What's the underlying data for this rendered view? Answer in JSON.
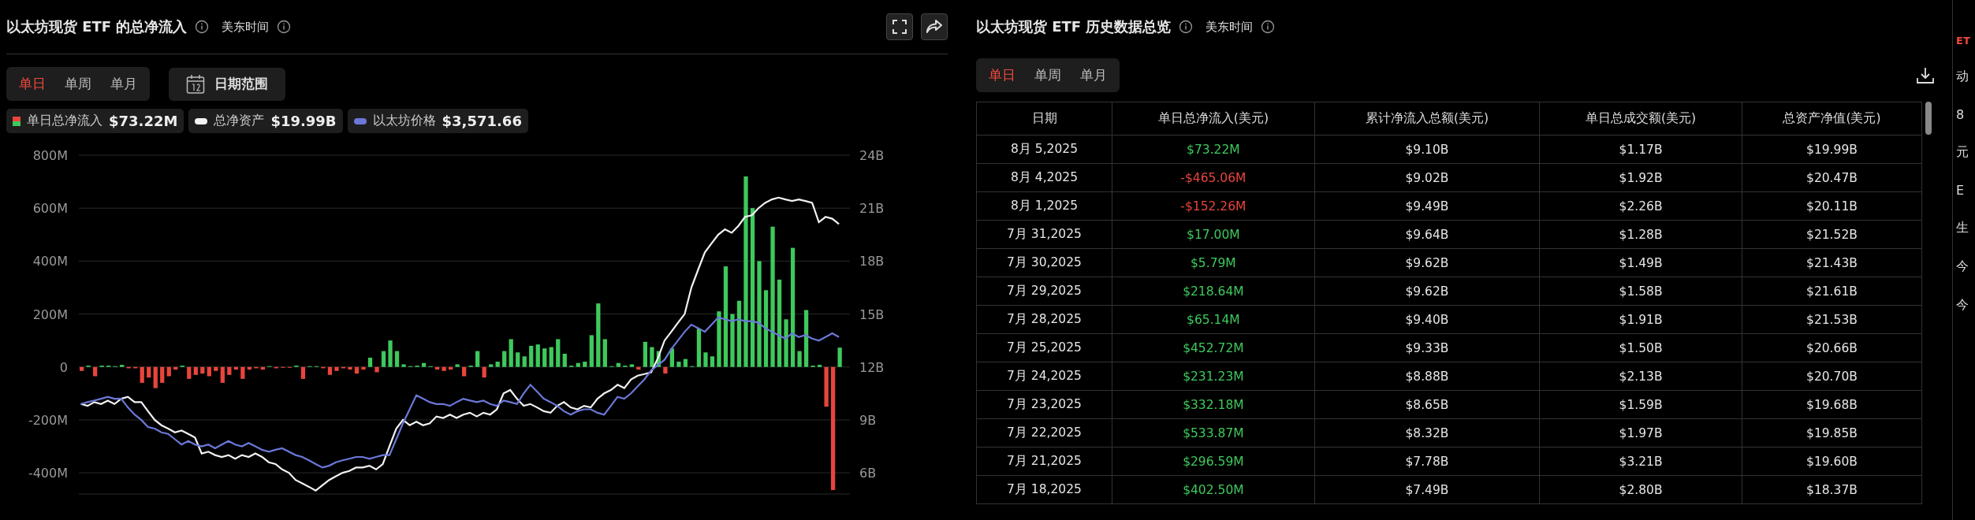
{
  "left_panel": {
    "title": "以太坊现货 ETF 的总净流入",
    "timezone": "美东时间",
    "period_tabs": [
      {
        "label": "单日",
        "selected": true
      },
      {
        "label": "单周",
        "selected": false
      },
      {
        "label": "单月",
        "selected": false
      }
    ],
    "date_range_button": "日期范围",
    "legend": [
      {
        "value": "$73.22M"
      },
      {
        "value": "$19.99B"
      },
      {
        "value": "$3,571.66"
      }
    ],
    "chart_data": {
      "type": "bar",
      "grid": true,
      "stacked": true,
      "ylim": [
        -480,
        800
      ],
      "y2lim": [
        4.8,
        24
      ],
      "yticks": [
        {
          "value": 800,
          "label": "800M"
        },
        {
          "value": 600,
          "label": "600M"
        },
        {
          "value": 400,
          "label": "400M"
        },
        {
          "value": 200,
          "label": "200M"
        },
        {
          "value": 0,
          "label": "0"
        },
        {
          "value": -200,
          "label": "-200M"
        },
        {
          "value": -400,
          "label": "-400M"
        }
      ],
      "y2ticks": [
        {
          "value": 24,
          "label": "24B"
        },
        {
          "value": 21,
          "label": "21B"
        },
        {
          "value": 18,
          "label": "18B"
        },
        {
          "value": 15,
          "label": "15B"
        },
        {
          "value": 12,
          "label": "12B"
        },
        {
          "value": 9,
          "label": "9B"
        },
        {
          "value": 6,
          "label": "6B"
        }
      ],
      "series": [
        {
          "name": "单日总净流入",
          "type": "bar",
          "color": "#3ec95c",
          "values": [
            null,
            5,
            null,
            5,
            5,
            3,
            8,
            null,
            null,
            null,
            null,
            null,
            null,
            null,
            null,
            5,
            null,
            null,
            null,
            null,
            null,
            null,
            null,
            null,
            null,
            null,
            null,
            null,
            3,
            null,
            null,
            null,
            5,
            null,
            3,
            3,
            null,
            null,
            null,
            null,
            null,
            null,
            null,
            35,
            null,
            60,
            100,
            60,
            10,
            3,
            5,
            15,
            3,
            null,
            null,
            null,
            10,
            null,
            5,
            60,
            null,
            10,
            20,
            60,
            105,
            55,
            40,
            80,
            85,
            70,
            75,
            105,
            50,
            5,
            15,
            20,
            120,
            240,
            105,
            3,
            15,
            5,
            10,
            null,
            95,
            75,
            60,
            null,
            70,
            20,
            30,
            3,
            145,
            55,
            40,
            210,
            380,
            200,
            250,
            720,
            600,
            400,
            290,
            530,
            330,
            180,
            450,
            60,
            215,
            5,
            8,
            null,
            null,
            73
          ]
        },
        {
          "name": "总净资产",
          "type": "line",
          "color": "#f2f2f2",
          "values": [
            -140,
            -147,
            -133,
            -140,
            -127,
            -140,
            -120,
            -113,
            -133,
            -133,
            -167,
            -200,
            -220,
            -233,
            -247,
            -240,
            -253,
            -267,
            -327,
            -320,
            -333,
            -340,
            -333,
            -347,
            -333,
            -340,
            -327,
            -340,
            -360,
            -367,
            -387,
            -400,
            -427,
            -440,
            -453,
            -467,
            -447,
            -427,
            -413,
            -400,
            -393,
            -380,
            -380,
            -373,
            -387,
            -367,
            -300,
            -233,
            -200,
            -220,
            -207,
            -220,
            -213,
            -187,
            -193,
            -180,
            -193,
            -180,
            -173,
            -187,
            -173,
            -180,
            -160,
            -100,
            -87,
            -120,
            -147,
            -140,
            -153,
            -167,
            -173,
            -147,
            -133,
            -153,
            -160,
            -147,
            -153,
            -120,
            -100,
            -87,
            -67,
            -80,
            -47,
            -33,
            -27,
            -20,
            33,
            100,
            133,
            167,
            200,
            300,
            367,
            433,
            467,
            500,
            520,
            507,
            533,
            567,
            573,
            600,
            620,
            633,
            640,
            633,
            627,
            633,
            627,
            620,
            547,
            567,
            560,
            540
          ]
        },
        {
          "name": "以太坊价格",
          "type": "line",
          "color": "#6b78d8",
          "values": [
            -140,
            -133,
            -127,
            -120,
            -113,
            -120,
            -120,
            -153,
            -180,
            -200,
            -227,
            -233,
            -247,
            -253,
            -273,
            -293,
            -280,
            -293,
            -300,
            -293,
            -307,
            -293,
            -280,
            -293,
            -300,
            -287,
            -300,
            -313,
            -320,
            -313,
            -307,
            -320,
            -333,
            -340,
            -353,
            -367,
            -380,
            -373,
            -360,
            -353,
            -347,
            -340,
            -340,
            -347,
            -340,
            -333,
            -333,
            -273,
            -213,
            -160,
            -107,
            -120,
            -133,
            -140,
            -140,
            -147,
            -133,
            -120,
            -127,
            -133,
            -127,
            -140,
            -147,
            -127,
            -133,
            -140,
            -100,
            -67,
            -93,
            -120,
            -133,
            -147,
            -167,
            -180,
            -167,
            -160,
            -160,
            -173,
            -180,
            -147,
            -113,
            -120,
            -100,
            -73,
            -47,
            -13,
            7,
            27,
            67,
            100,
            133,
            160,
            147,
            133,
            160,
            187,
            180,
            173,
            180,
            173,
            173,
            167,
            147,
            133,
            120,
            107,
            127,
            113,
            120,
            107,
            100,
            113,
            127,
            113
          ]
        },
        {
          "type": "bar",
          "color": "#e8453c",
          "values": [
            -15,
            null,
            -35,
            null,
            null,
            null,
            null,
            -5,
            -5,
            -60,
            -40,
            -80,
            -60,
            -35,
            -10,
            null,
            -45,
            -30,
            -25,
            -35,
            -15,
            -60,
            -30,
            -10,
            -45,
            -10,
            -5,
            -10,
            null,
            -5,
            -3,
            -3,
            null,
            -45,
            null,
            null,
            -5,
            -30,
            -15,
            -5,
            -10,
            -25,
            -10,
            null,
            -20,
            null,
            null,
            null,
            null,
            null,
            null,
            null,
            null,
            -10,
            -15,
            -10,
            null,
            -35,
            null,
            null,
            -40,
            null,
            null,
            null,
            null,
            null,
            null,
            null,
            null,
            null,
            null,
            null,
            null,
            null,
            null,
            null,
            null,
            null,
            null,
            null,
            null,
            null,
            null,
            -10,
            null,
            null,
            null,
            -25,
            null,
            null,
            null,
            null,
            null,
            null,
            null,
            null,
            null,
            null,
            null,
            null,
            null,
            null,
            null,
            null,
            null,
            null,
            null,
            null,
            null,
            null,
            null,
            -150,
            -465,
            null
          ]
        }
      ]
    }
  },
  "right_panel": {
    "title": "以太坊现货 ETF 历史数据总览",
    "timezone": "美东时间",
    "period_tabs": [
      {
        "label": "单日",
        "selected": true
      },
      {
        "label": "单周",
        "selected": false
      },
      {
        "label": "单月",
        "selected": false
      }
    ],
    "table": {
      "columns": [
        "日期",
        "单日总净流入(美元)",
        "累计净流入总额(美元)",
        "单日总成交额(美元)",
        "总资产净值(美元)"
      ],
      "rows": [
        {
          "date": "8月 5,2025",
          "inflow": "$73.22M",
          "color": "#3ec95c",
          "cumulative": "$9.10B",
          "volume": "$1.17B",
          "net_assets": "$19.99B"
        },
        {
          "date": "8月 4,2025",
          "inflow": "-$465.06M",
          "color": "#e8453c",
          "cumulative": "$9.02B",
          "volume": "$1.92B",
          "net_assets": "$20.47B"
        },
        {
          "date": "8月 1,2025",
          "inflow": "-$152.26M",
          "color": "#e8453c",
          "cumulative": "$9.49B",
          "volume": "$2.26B",
          "net_assets": "$20.11B"
        },
        {
          "date": "7月 31,2025",
          "inflow": "$17.00M",
          "color": "#3ec95c",
          "cumulative": "$9.64B",
          "volume": "$1.28B",
          "net_assets": "$21.52B"
        },
        {
          "date": "7月 30,2025",
          "inflow": "$5.79M",
          "color": "#3ec95c",
          "cumulative": "$9.62B",
          "volume": "$1.49B",
          "net_assets": "$21.43B"
        },
        {
          "date": "7月 29,2025",
          "inflow": "$218.64M",
          "color": "#3ec95c",
          "cumulative": "$9.62B",
          "volume": "$1.58B",
          "net_assets": "$21.61B"
        },
        {
          "date": "7月 28,2025",
          "inflow": "$65.14M",
          "color": "#3ec95c",
          "cumulative": "$9.40B",
          "volume": "$1.91B",
          "net_assets": "$21.53B"
        },
        {
          "date": "7月 25,2025",
          "inflow": "$452.72M",
          "color": "#3ec95c",
          "cumulative": "$9.33B",
          "volume": "$1.50B",
          "net_assets": "$20.66B"
        },
        {
          "date": "7月 24,2025",
          "inflow": "$231.23M",
          "color": "#3ec95c",
          "cumulative": "$8.88B",
          "volume": "$2.13B",
          "net_assets": "$20.70B"
        },
        {
          "date": "7月 23,2025",
          "inflow": "$332.18M",
          "color": "#3ec95c",
          "cumulative": "$8.65B",
          "volume": "$1.59B",
          "net_assets": "$19.68B"
        },
        {
          "date": "7月 22,2025",
          "inflow": "$533.87M",
          "color": "#3ec95c",
          "cumulative": "$8.32B",
          "volume": "$1.97B",
          "net_assets": "$19.85B"
        },
        {
          "date": "7月 21,2025",
          "inflow": "$296.59M",
          "color": "#3ec95c",
          "cumulative": "$7.78B",
          "volume": "$3.21B",
          "net_assets": "$19.60B"
        },
        {
          "date": "7月 18,2025",
          "inflow": "$402.50M",
          "color": "#3ec95c",
          "cumulative": "$7.49B",
          "volume": "$2.80B",
          "net_assets": "$18.37B"
        }
      ]
    }
  },
  "side_strip": {
    "items": [
      "ET",
      "动",
      "8",
      "元",
      "E",
      "生",
      "今",
      "今"
    ]
  }
}
